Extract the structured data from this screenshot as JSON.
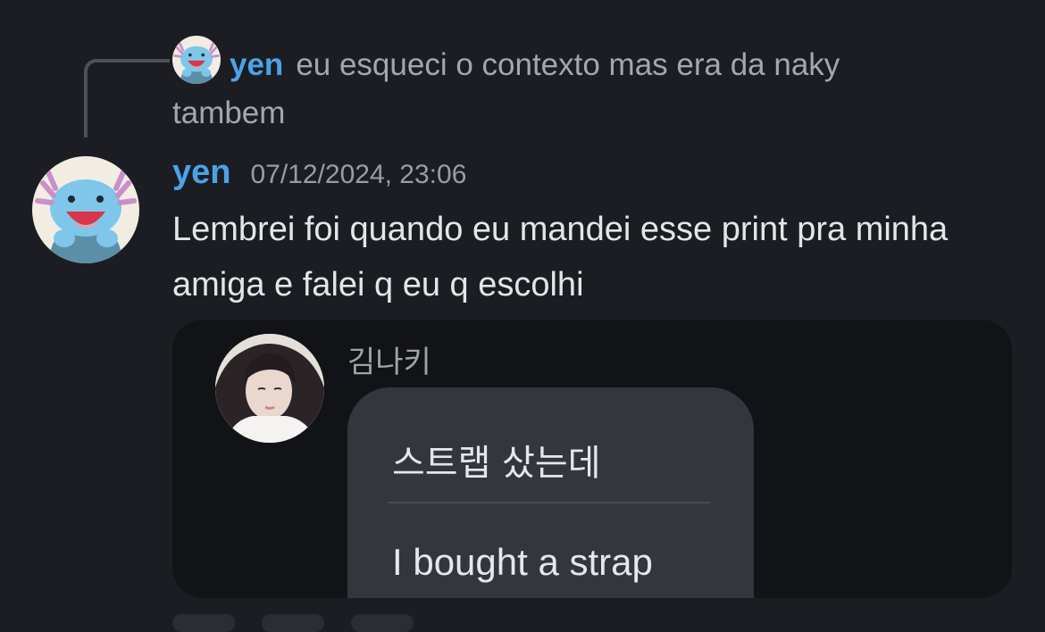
{
  "reply": {
    "author": "yen",
    "text": "eu esqueci o contexto mas era da naky tambem"
  },
  "message": {
    "author": "yen",
    "timestamp": "07/12/2024, 23:06",
    "content": "Lembrei foi quando eu mandei esse print pra minha amiga e falei q eu q escolhi"
  },
  "attachment": {
    "sender_name": "김나키",
    "korean_text": "스트랩 샀는데",
    "translation": "I bought a strap"
  },
  "colors": {
    "background": "#1c1d22",
    "author": "#4aa3e8",
    "attachment_bg": "#121316",
    "bubble_bg": "#34363d"
  },
  "icons": {
    "avatar": "wooper-avatar-icon"
  }
}
